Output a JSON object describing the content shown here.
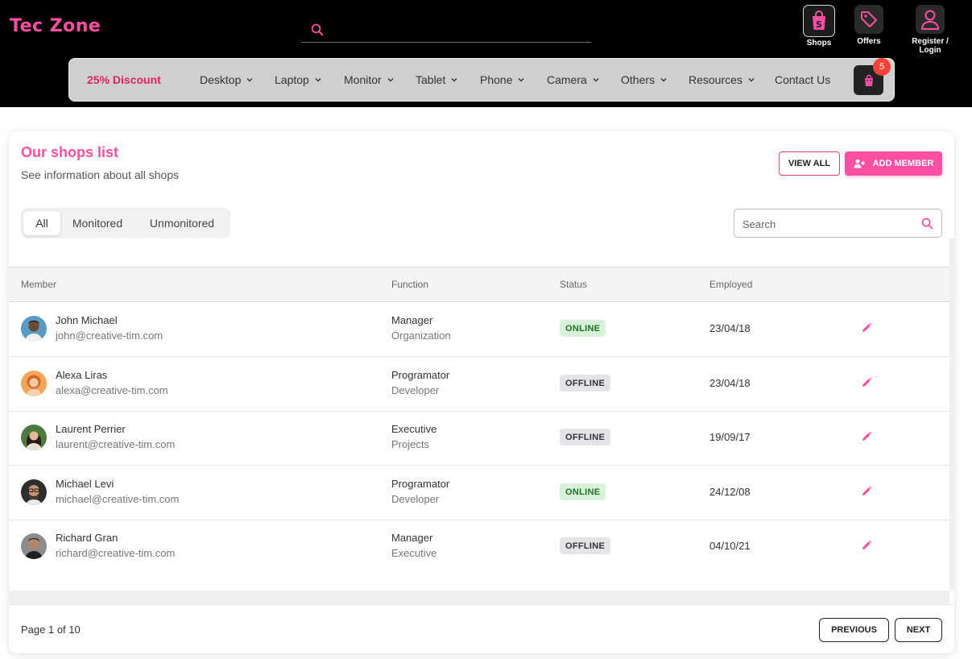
{
  "header": {
    "logo": "Tec Zone",
    "search_value": "",
    "icons": [
      {
        "name": "shops",
        "label": "Shops"
      },
      {
        "name": "offers",
        "label": "Offers"
      },
      {
        "name": "register",
        "label": "Register / Login"
      }
    ]
  },
  "nav": {
    "discount": "25% Discount",
    "items": [
      "Desktop",
      "Laptop",
      "Monitor",
      "Tablet",
      "Phone",
      "Camera",
      "Others",
      "Resources",
      "Contact Us"
    ],
    "cart_count": "5"
  },
  "card": {
    "title": "Our shops list",
    "subtitle": "See information about all shops",
    "view_all": "VIEW ALL",
    "add_member": "ADD MEMBER",
    "tabs": [
      "All",
      "Monitored",
      "Unmonitored"
    ],
    "search_placeholder": "Search",
    "columns": [
      "Member",
      "Function",
      "Status",
      "Employed"
    ],
    "rows": [
      {
        "name": "John Michael",
        "email": "john@creative-tim.com",
        "function": "Manager",
        "function_sub": "Organization",
        "status": "ONLINE",
        "employed": "23/04/18"
      },
      {
        "name": "Alexa Liras",
        "email": "alexa@creative-tim.com",
        "function": "Programator",
        "function_sub": "Developer",
        "status": "OFFLINE",
        "employed": "23/04/18"
      },
      {
        "name": "Laurent Perrier",
        "email": "laurent@creative-tim.com",
        "function": "Executive",
        "function_sub": "Projects",
        "status": "OFFLINE",
        "employed": "19/09/17"
      },
      {
        "name": "Michael Levi",
        "email": "michael@creative-tim.com",
        "function": "Programator",
        "function_sub": "Developer",
        "status": "ONLINE",
        "employed": "24/12/08"
      },
      {
        "name": "Richard Gran",
        "email": "richard@creative-tim.com",
        "function": "Manager",
        "function_sub": "Executive",
        "status": "OFFLINE",
        "employed": "04/10/21"
      }
    ],
    "page_info": "Page 1 of 10",
    "previous": "PREVIOUS",
    "next": "NEXT"
  },
  "colors": {
    "accent": "#ff4fa3",
    "discount": "#e0245e",
    "online_bg": "#d8f1d8",
    "offline_bg": "#e2e4e8"
  }
}
